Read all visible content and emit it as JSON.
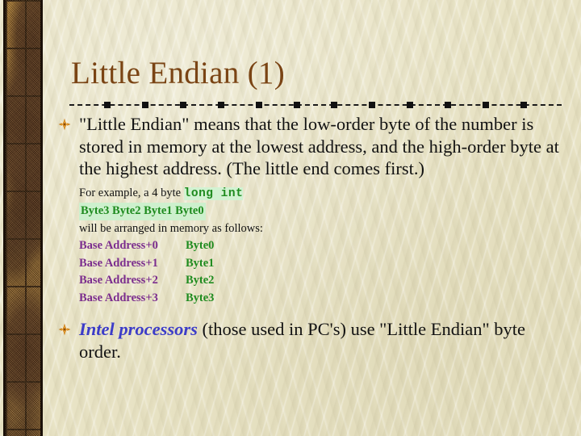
{
  "slide": {
    "title": "Little Endian (1)",
    "theme": {
      "background_color": "#e9e4c6",
      "title_color": "#7a4414",
      "body_color": "#121212",
      "code_color": "#1f8b1f",
      "address_color": "#7b2d8e",
      "intel_color": "#3c3cc8",
      "highlight_color": "#cdf0cd",
      "sidebar_color": "#a3702a"
    },
    "bullets": [
      {
        "marker": "star-bullet-icon",
        "text": "\"Little Endian\" means that the low-order byte of the number is stored in memory at the lowest address, and the high-order byte at the highest address. (The little end comes first.)"
      },
      {
        "marker": "star-bullet-icon",
        "text_lead": "Intel processors",
        "text_rest": " (those used in PC's) use \"Little Endian\" byte order."
      }
    ],
    "sub_block": {
      "intro_prefix": "For example, a 4 byte ",
      "intro_code": "long int",
      "byte_order_row": "Byte3   Byte2   Byte1   Byte0",
      "arranged_line": "will be arranged in memory as follows:",
      "memory_map": [
        {
          "address": "Base Address+0",
          "value": "Byte0"
        },
        {
          "address": "Base Address+1",
          "value": "Byte1"
        },
        {
          "address": "Base Address+2",
          "value": "Byte2"
        },
        {
          "address": "Base Address+3",
          "value": "Byte3"
        }
      ]
    },
    "decor": {
      "divider_name": "dashed-square-divider",
      "sidebar_name": "brick-texture-sidebar"
    }
  }
}
